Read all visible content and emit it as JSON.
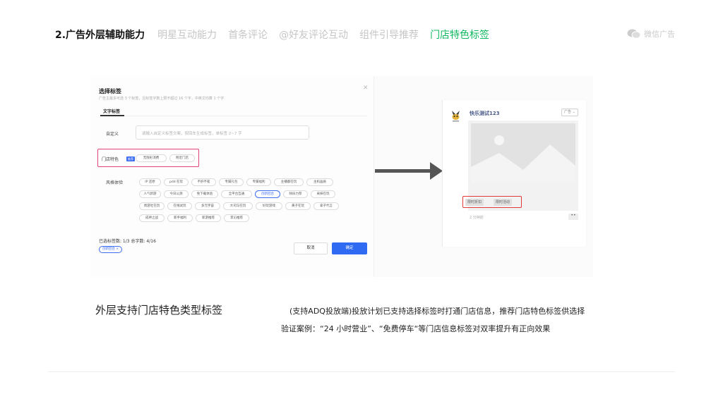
{
  "header": {
    "section_title": "2.广告外层辅助能力",
    "tabs": [
      {
        "label": "明星互动能力",
        "active": false
      },
      {
        "label": "首条评论",
        "active": false
      },
      {
        "label": "@好友评论互动",
        "active": false
      },
      {
        "label": "组件引导推荐",
        "active": false
      },
      {
        "label": "门店特色标签",
        "active": true
      }
    ],
    "brand": {
      "label": "微信广告",
      "icon": "wechat-icon"
    }
  },
  "dialog": {
    "title": "选择标签",
    "subtitle": "广告主最多可选 3 个标签，且标签字数上限不超过 16 个字，中英文均算 1 个字",
    "close_icon": "close-icon",
    "tab": "文字标签",
    "custom_label": "自定义",
    "custom_placeholder": "请输入自定义标签文案，按回车生成标签，单标签 2~7 字",
    "store_label": "门店特色",
    "store_badge": "推荐",
    "store_chips": [
      "无限形消费",
      "附近门店"
    ],
    "style_label": "风格体验",
    "style_chips": [
      [
        "IP 还原",
        "pdd 在玩",
        "不肝不氪",
        "专属礼包",
        "专属福利",
        "主播都在玩",
        "主机画质"
      ],
      [
        "人气新游",
        "今日公测",
        "免下载体验",
        "全平台互通",
        "创新回合",
        "除旧力荐",
        "采抹在玩"
      ],
      [
        "周游吐在玩",
        "在线试玩",
        "多元宇宙",
        "大司马在玩",
        "好玩游戏",
        "黄子在玩",
        "拿子代言"
      ],
      [
        "成神之战",
        "新手福利",
        "新游推荐",
        "李沁推荐"
      ]
    ],
    "selected_chip": "创新回合",
    "summary": "已选标签数: 1/3  总字数: 4/16",
    "selected_tag": "创新回合 ×",
    "cancel_label": "取消",
    "confirm_label": "确定"
  },
  "preview": {
    "name": "快乐测试123",
    "ad_badge": "广告 ⌄",
    "tags": [
      "限时折扣",
      "限时活动"
    ],
    "time": "2 分钟前",
    "more": "••"
  },
  "captions": {
    "left": "外层支持门店特色类型标签",
    "right_line1": "(支持ADQ投放端)投放计划已支持选择标签时打通门店信息，推荐门店特色标签供选择",
    "right_line2": "验证案例：“24 小时营业”、“免费停车“等门店信息标签对双率提升有正向效果"
  },
  "colors": {
    "accent_green": "#12b861",
    "primary_blue": "#2f6bf2",
    "highlight_pink": "#e0447a",
    "highlight_red": "#e03a3a"
  }
}
